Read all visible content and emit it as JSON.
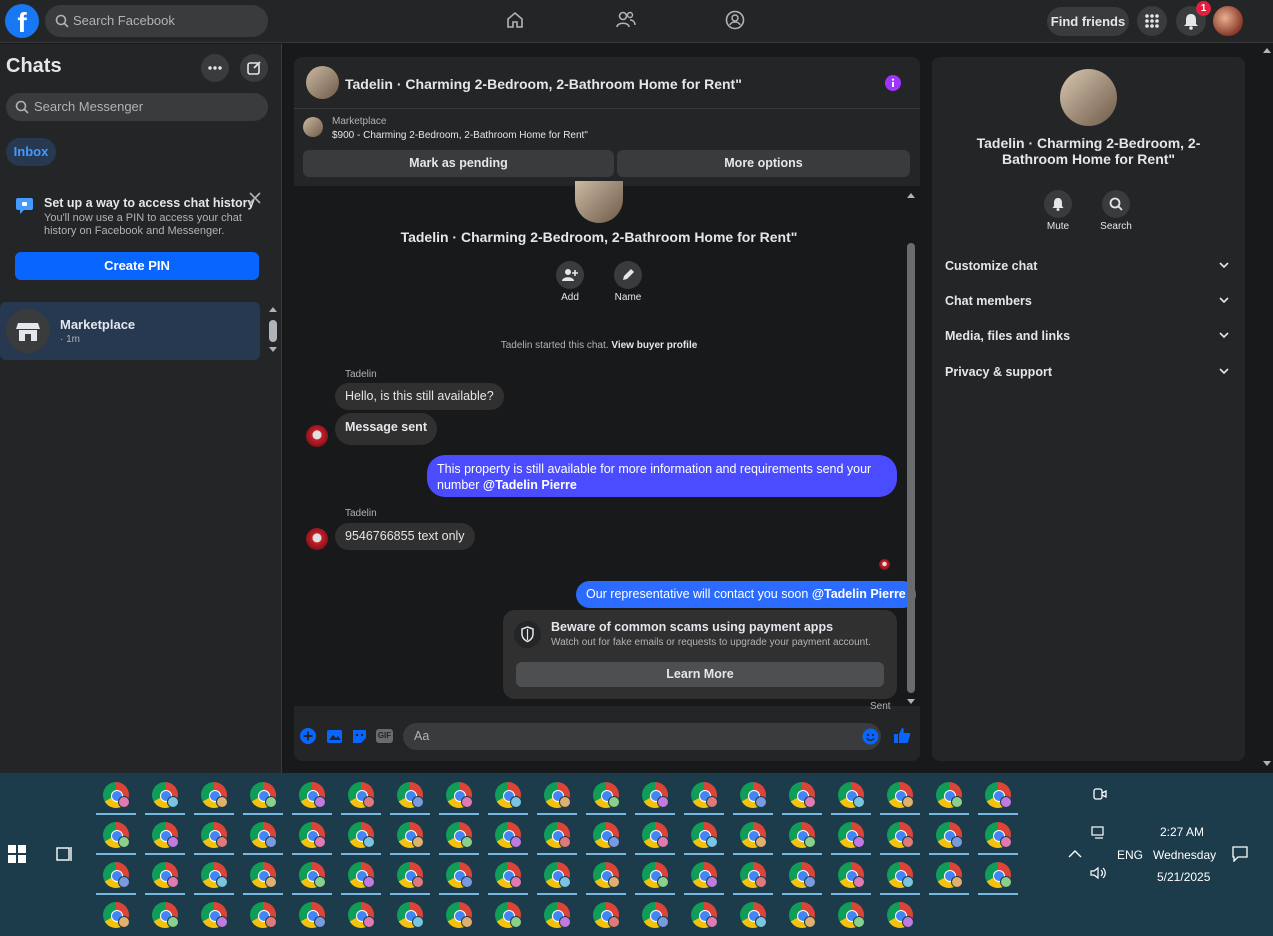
{
  "topbar": {
    "search_placeholder": "Search Facebook",
    "find_friends": "Find friends",
    "notification_count": "1",
    "logo_letter": "f"
  },
  "sidebar": {
    "title": "Chats",
    "search_placeholder": "Search Messenger",
    "inbox_tab": "Inbox",
    "pin_card": {
      "title": "Set up a way to access chat history",
      "desc": "You'll now use a PIN to access your chat history on Facebook and Messenger.",
      "button": "Create PIN"
    },
    "chat_item": {
      "name": "Marketplace",
      "time": "· 1m"
    }
  },
  "chat": {
    "header_title": "Tadelin · Charming 2-Bedroom, 2-Bathroom Home for Rent\"",
    "marketplace_label": "Marketplace",
    "listing": "$900 - Charming 2-Bedroom, 2-Bathroom Home for Rent\"",
    "mark_pending": "Mark as pending",
    "more_options": "More options",
    "conv_title": "Tadelin · Charming 2-Bedroom, 2-Bathroom Home for Rent\"",
    "add_label": "Add",
    "name_label": "Name",
    "started_text": "Tadelin started this chat.",
    "view_buyer": "View buyer profile",
    "messages": [
      {
        "sender": "Tadelin",
        "text": "Hello, is this still available?"
      },
      {
        "text": "Message sent"
      },
      {
        "text": "This property is still available for more information and requirements send your number",
        "mention": "@Tadelin Pierre"
      },
      {
        "sender": "Tadelin",
        "text": "9546766855 text only"
      },
      {
        "text": "Our representative will contact you soon",
        "mention": "@Tadelin Pierre"
      }
    ],
    "scam": {
      "title": "Beware of common scams using payment apps",
      "desc": "Watch out for fake emails or requests to upgrade your payment account.",
      "button": "Learn More"
    },
    "sent_label": "Sent",
    "input_placeholder": "Aa",
    "gif_label": "GIF"
  },
  "info": {
    "title": "Tadelin · Charming 2-Bedroom, 2-Bathroom Home for Rent\"",
    "mute": "Mute",
    "search": "Search",
    "rows": [
      "Customize chat",
      "Chat members",
      "Media, files and links",
      "Privacy & support"
    ]
  },
  "taskbar": {
    "time": "2:27 AM",
    "day": "Wednesday",
    "date": "5/21/2025",
    "lang": "ENG"
  },
  "colors": {
    "accent": "#0866ff",
    "outgoing_bubble": "#4b4cff",
    "info_icon": "#a033ff",
    "taskbar": "#1c3b4b"
  }
}
